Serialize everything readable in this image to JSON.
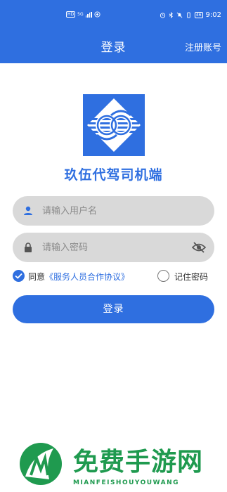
{
  "status_bar": {
    "left_chip": "HD",
    "network": "5G",
    "battery": "46",
    "time": "9:02"
  },
  "nav": {
    "title": "登录",
    "register": "注册账号"
  },
  "app_title": "玖伍代驾司机端",
  "username": {
    "placeholder": "请输入用户名",
    "icon": "user-icon"
  },
  "password": {
    "placeholder": "请输入密码",
    "icon": "lock-icon",
    "toggle_icon": "eye-off-icon"
  },
  "agreement": {
    "prefix": "同意",
    "link": "《服务人员合作协议》",
    "checked": true
  },
  "remember": {
    "label": "记住密码",
    "checked": false
  },
  "login_button": "登录",
  "watermark": {
    "title": "免费手游网",
    "subtitle": "MIANFEISHOUYOUWANG",
    "color": "#1f9a4f"
  },
  "colors": {
    "primary": "#2f6fe0",
    "field": "#d9d9d9"
  }
}
